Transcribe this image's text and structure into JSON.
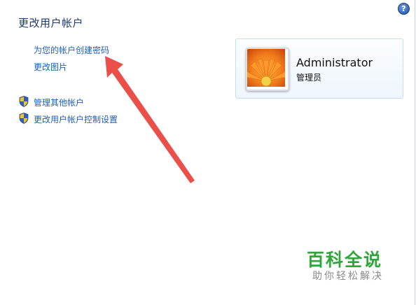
{
  "header": {
    "help_icon": "help-icon",
    "help_label": "?"
  },
  "page": {
    "title": "更改用户帐户"
  },
  "links": {
    "create_password": "为您的帐户创建密码",
    "change_picture": "更改图片",
    "manage_accounts": "管理其他帐户",
    "uac_settings": "更改用户帐户控制设置"
  },
  "account": {
    "name": "Administrator",
    "role": "管理员",
    "picture_icon": "flower-picture"
  },
  "watermark": {
    "title": "百科全说",
    "subtitle": "助你轻松解决"
  },
  "colors": {
    "link": "#1f5fb0",
    "title": "#1e3a6e",
    "watermark_green": "#2fa53a",
    "annotation_arrow": "#e8403a"
  }
}
